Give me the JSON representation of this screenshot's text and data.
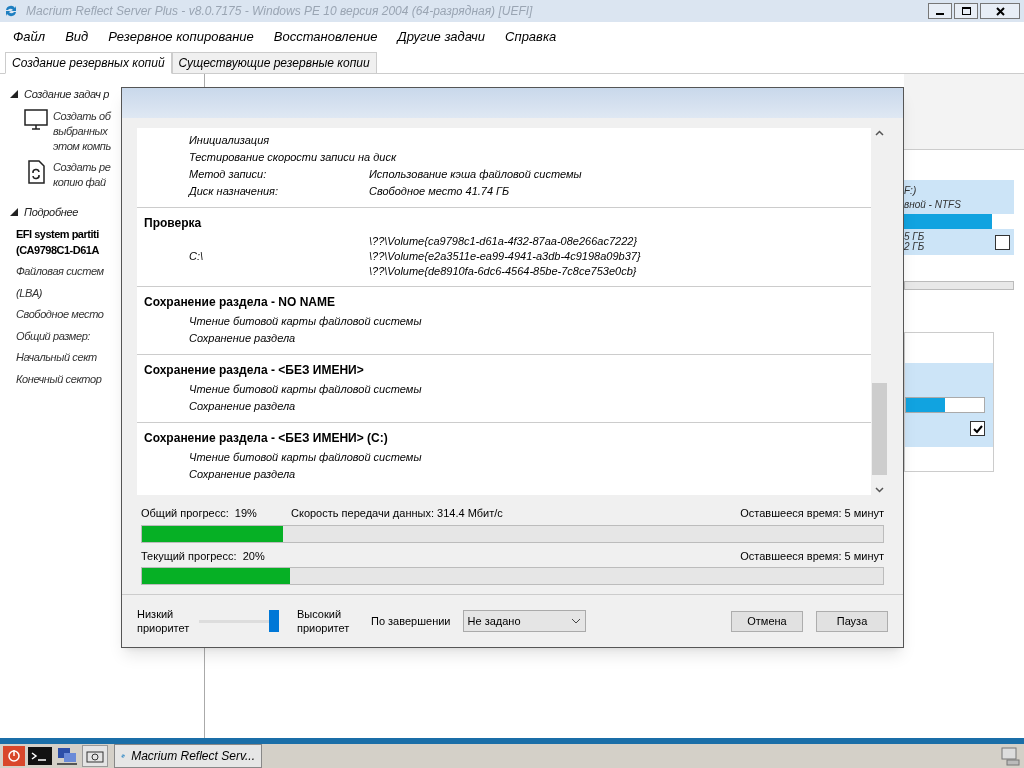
{
  "window": {
    "title": "Macrium Reflect Server Plus - v8.0.7175 - Windows PE 10 версия 2004 (64-разрядная)  [UEFI]"
  },
  "menu": [
    "Файл",
    "Вид",
    "Резервное копирование",
    "Восстановление",
    "Другие задачи",
    "Справка"
  ],
  "tabs": [
    {
      "label": "Создание резервных копий",
      "selected": true
    },
    {
      "label": "Существующие резервные копии",
      "selected": false
    }
  ],
  "sidebar": {
    "sections": [
      {
        "title": "Создание задач р",
        "expanded": true,
        "kind": "tasks",
        "items": [
          {
            "lines": [
              "Создать об",
              "выбранных",
              "этом компь"
            ]
          },
          {
            "lines": [
              "Создать ре",
              "копию фай"
            ]
          }
        ]
      },
      {
        "title": "Подробнее",
        "expanded": true,
        "kind": "details",
        "heading": [
          "EFI system partiti",
          "(CA9798C1-D61A"
        ],
        "fields": [
          "Файловая систем",
          "(LBA)",
          "Свободное место",
          "Общий размер:",
          "Начальный сект",
          "Конечный сектор"
        ]
      }
    ]
  },
  "right_panel": {
    "disk": {
      "lines": [
        "F:)",
        "вной - NTFS"
      ],
      "level": 0.8,
      "sizes": [
        "5 ГБ",
        "2 ГБ"
      ],
      "checked": false
    },
    "partition": {
      "level": 0.5,
      "checked": true
    }
  },
  "dialog": {
    "log": [
      {
        "rows": [
          {
            "label": "Инициализация"
          },
          {
            "label": "Тестирование скорости записи на диск"
          },
          {
            "label": "Метод записи:",
            "values": [
              "Использование кэша файловой системы"
            ]
          },
          {
            "label": "Диск назначения:",
            "values": [
              "Свободное место 41.74 ГБ"
            ]
          }
        ]
      },
      {
        "title": "Проверка",
        "rows": [
          {
            "label": "C:\\",
            "values": [
              "\\??\\Volume{ca9798c1-d61a-4f32-87aa-08e266ac7222}",
              "\\??\\Volume{e2a3511e-ea99-4941-a3db-4c9198a09b37}",
              "\\??\\Volume{de8910fa-6dc6-4564-85be-7c8ce753e0cb}"
            ]
          }
        ]
      },
      {
        "title": "Сохранение раздела - NO NAME",
        "rows": [
          {
            "label": "Чтение битовой карты файловой системы"
          },
          {
            "label": "Сохранение раздела"
          }
        ]
      },
      {
        "title": "Сохранение раздела - <БЕЗ ИМЕНИ>",
        "rows": [
          {
            "label": "Чтение битовой карты файловой системы"
          },
          {
            "label": "Сохранение раздела"
          }
        ]
      },
      {
        "title": "Сохранение раздела - <БЕЗ ИМЕНИ> (C:)",
        "rows": [
          {
            "label": "Чтение битовой карты файловой системы"
          },
          {
            "label": "Сохранение раздела"
          }
        ]
      }
    ],
    "progress": [
      {
        "label": "Общий прогресс:  19%",
        "speed": "Скорость передачи данных: 314.4 Мбит/с",
        "remaining": "Оставшееся время: 5 минут",
        "level": 0.19
      },
      {
        "label": "Текущий прогресс:  20%",
        "remaining": "Оставшееся время: 5 минут",
        "level": 0.2
      }
    ],
    "priority": {
      "low": "Низкий приоритет",
      "high": "Высокий приоритет",
      "level": 1
    },
    "on_complete": {
      "label": "По завершении",
      "value": "Не задано"
    },
    "buttons": [
      "Отмена",
      "Пауза"
    ]
  },
  "taskbar": {
    "app": "Macrium Reflect Serv..."
  }
}
